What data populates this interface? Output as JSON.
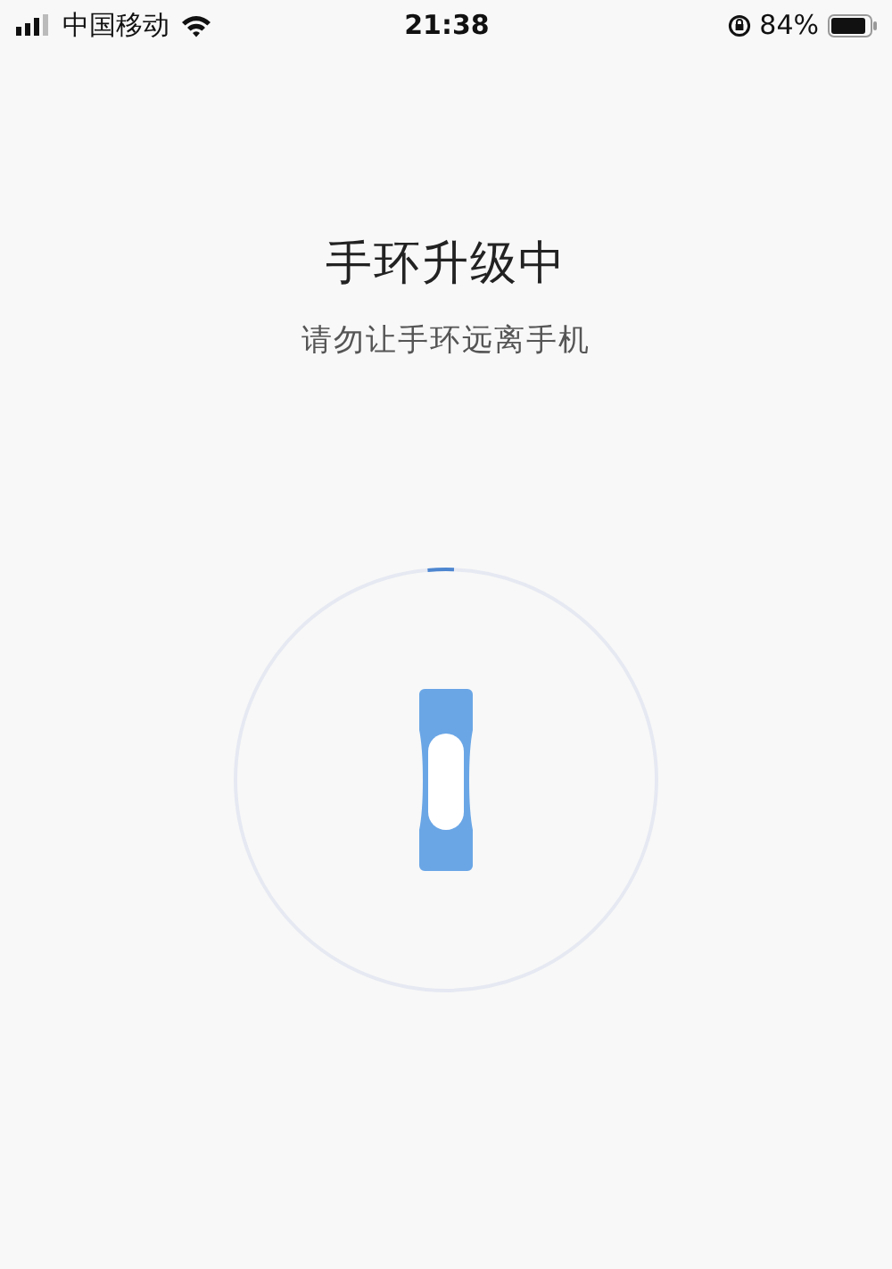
{
  "status_bar": {
    "carrier": "中国移动",
    "time": "21:38",
    "battery": "84%"
  },
  "title": "手环升级中",
  "subtitle": "请勿让手环远离手机",
  "progress": {
    "level": 0.02
  }
}
